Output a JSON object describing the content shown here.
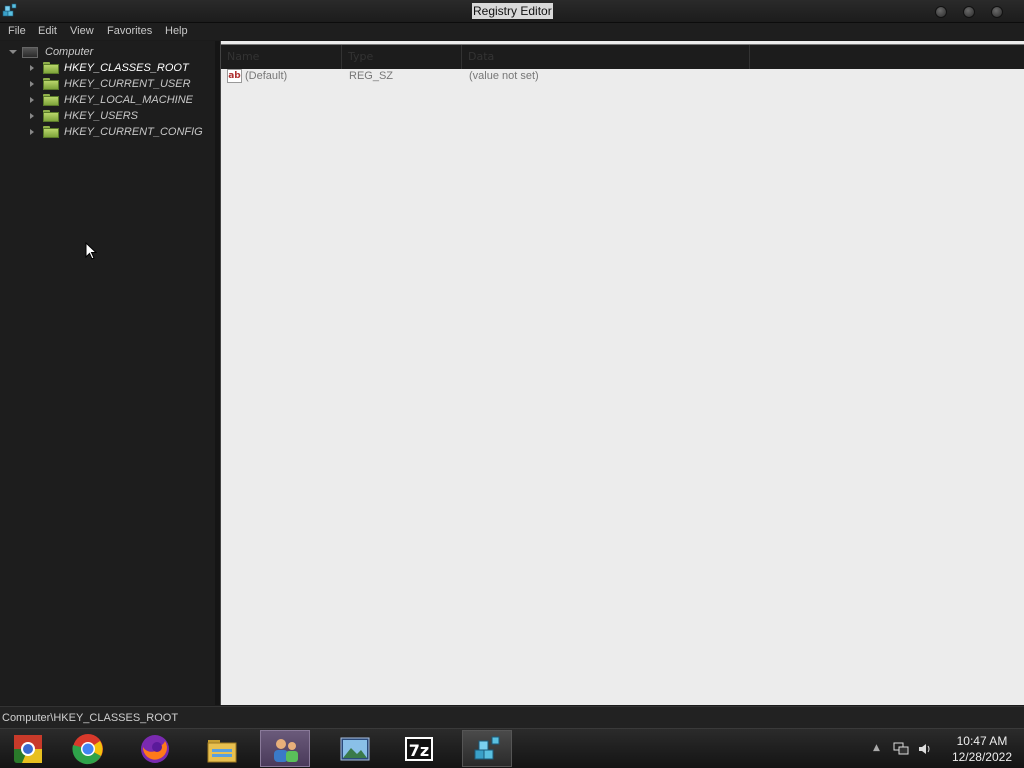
{
  "window": {
    "title": "Registry Editor"
  },
  "menu": [
    "File",
    "Edit",
    "View",
    "Favorites",
    "Help"
  ],
  "tree": {
    "root": "Computer",
    "keys": [
      "HKEY_CLASSES_ROOT",
      "HKEY_CURRENT_USER",
      "HKEY_LOCAL_MACHINE",
      "HKEY_USERS",
      "HKEY_CURRENT_CONFIG"
    ]
  },
  "values": {
    "columns": [
      "Name",
      "Type",
      "Data"
    ],
    "rows": [
      {
        "name": "(Default)",
        "type": "REG_SZ",
        "data": "(value not set)"
      }
    ]
  },
  "status": {
    "path": "Computer\\HKEY_CLASSES_ROOT"
  },
  "taskbar": {
    "apps": [
      "chromium-icon",
      "chrome-icon",
      "firefox-icon",
      "file-explorer-icon",
      "users-icon",
      "photos-icon",
      "7zip-icon",
      "registry-editor-icon"
    ],
    "sevenzip_label": "7z",
    "clock_time": "10:47 AM",
    "clock_date": "12/28/2022"
  },
  "colors": {
    "values_bg": "#ececec",
    "tree_bg": "#1d1d1d",
    "title_bg": "#d9d9d9"
  }
}
